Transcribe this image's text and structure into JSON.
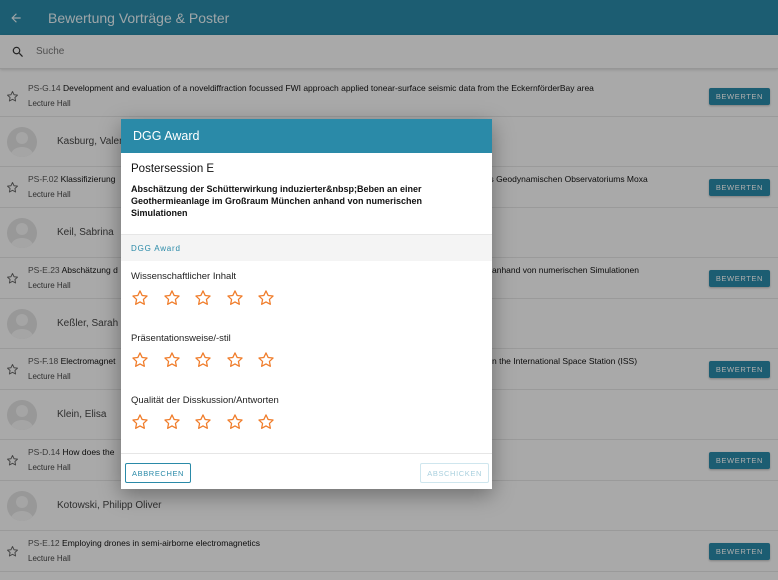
{
  "appbar": {
    "title": "Bewertung Vorträge & Poster",
    "back_icon": "arrow-left-icon"
  },
  "search": {
    "placeholder": "Suche"
  },
  "colors": {
    "primary": "#2a8aa8",
    "star": "#f07d2b"
  },
  "list": {
    "talks": [
      {
        "code": "PS-G.14",
        "title": "Development and evaluation of a noveldiffraction focussed FWI approach applied tonear-surface seismic data from the EckernförderBay area",
        "room": "Lecture Hall",
        "button": "BEWERTEN"
      },
      {
        "code": "PS-F.02",
        "title": "Klassifizierung",
        "title_tail": "des Geodynamischen Observatoriums Moxa",
        "room": "Lecture Hall",
        "button": "BEWERTEN"
      },
      {
        "code": "PS-E.23",
        "title": "Abschätzung d",
        "title_tail": "anhand von numerischen Simulationen",
        "room": "Lecture Hall",
        "button": "BEWERTEN"
      },
      {
        "code": "PS-F.18",
        "title": "Electromagnet",
        "title_tail": "n the International Space Station (ISS)",
        "room": "Lecture Hall",
        "button": "BEWERTEN"
      },
      {
        "code": "PS-D.14",
        "title": "How does the",
        "title_tail": "",
        "room": "Lecture Hall",
        "button": "BEWERTEN"
      },
      {
        "code": "PS-E.12",
        "title": "Employing drones in semi-airborne electromagnetics",
        "title_tail": "",
        "room": "Lecture Hall",
        "button": "BEWERTEN"
      }
    ],
    "people": [
      {
        "name": "Kasburg, Valen"
      },
      {
        "name": "Keil, Sabrina"
      },
      {
        "name": "Keßler, Sarah S"
      },
      {
        "name": "Klein, Elisa"
      },
      {
        "name": "Kotowski, Philipp Oliver"
      }
    ]
  },
  "dialog": {
    "title": "DGG Award",
    "session": "Postersession E",
    "abstract_title": "Abschätzung der Schütterwirkung induzierter&nbsp;Beben an einer Geothermieanlage im Großraum München anhand von numerischen Simulationen",
    "section_label": "DGG Award",
    "criteria": [
      {
        "label": "Wissenschaftlicher Inhalt",
        "rating": 0,
        "max": 5
      },
      {
        "label": "Präsentationsweise/-stil",
        "rating": 0,
        "max": 5
      },
      {
        "label": "Qualität der Disskussion/Antworten",
        "rating": 0,
        "max": 5
      }
    ],
    "cancel_label": "ABBRECHEN",
    "submit_label": "ABSCHICKEN"
  }
}
